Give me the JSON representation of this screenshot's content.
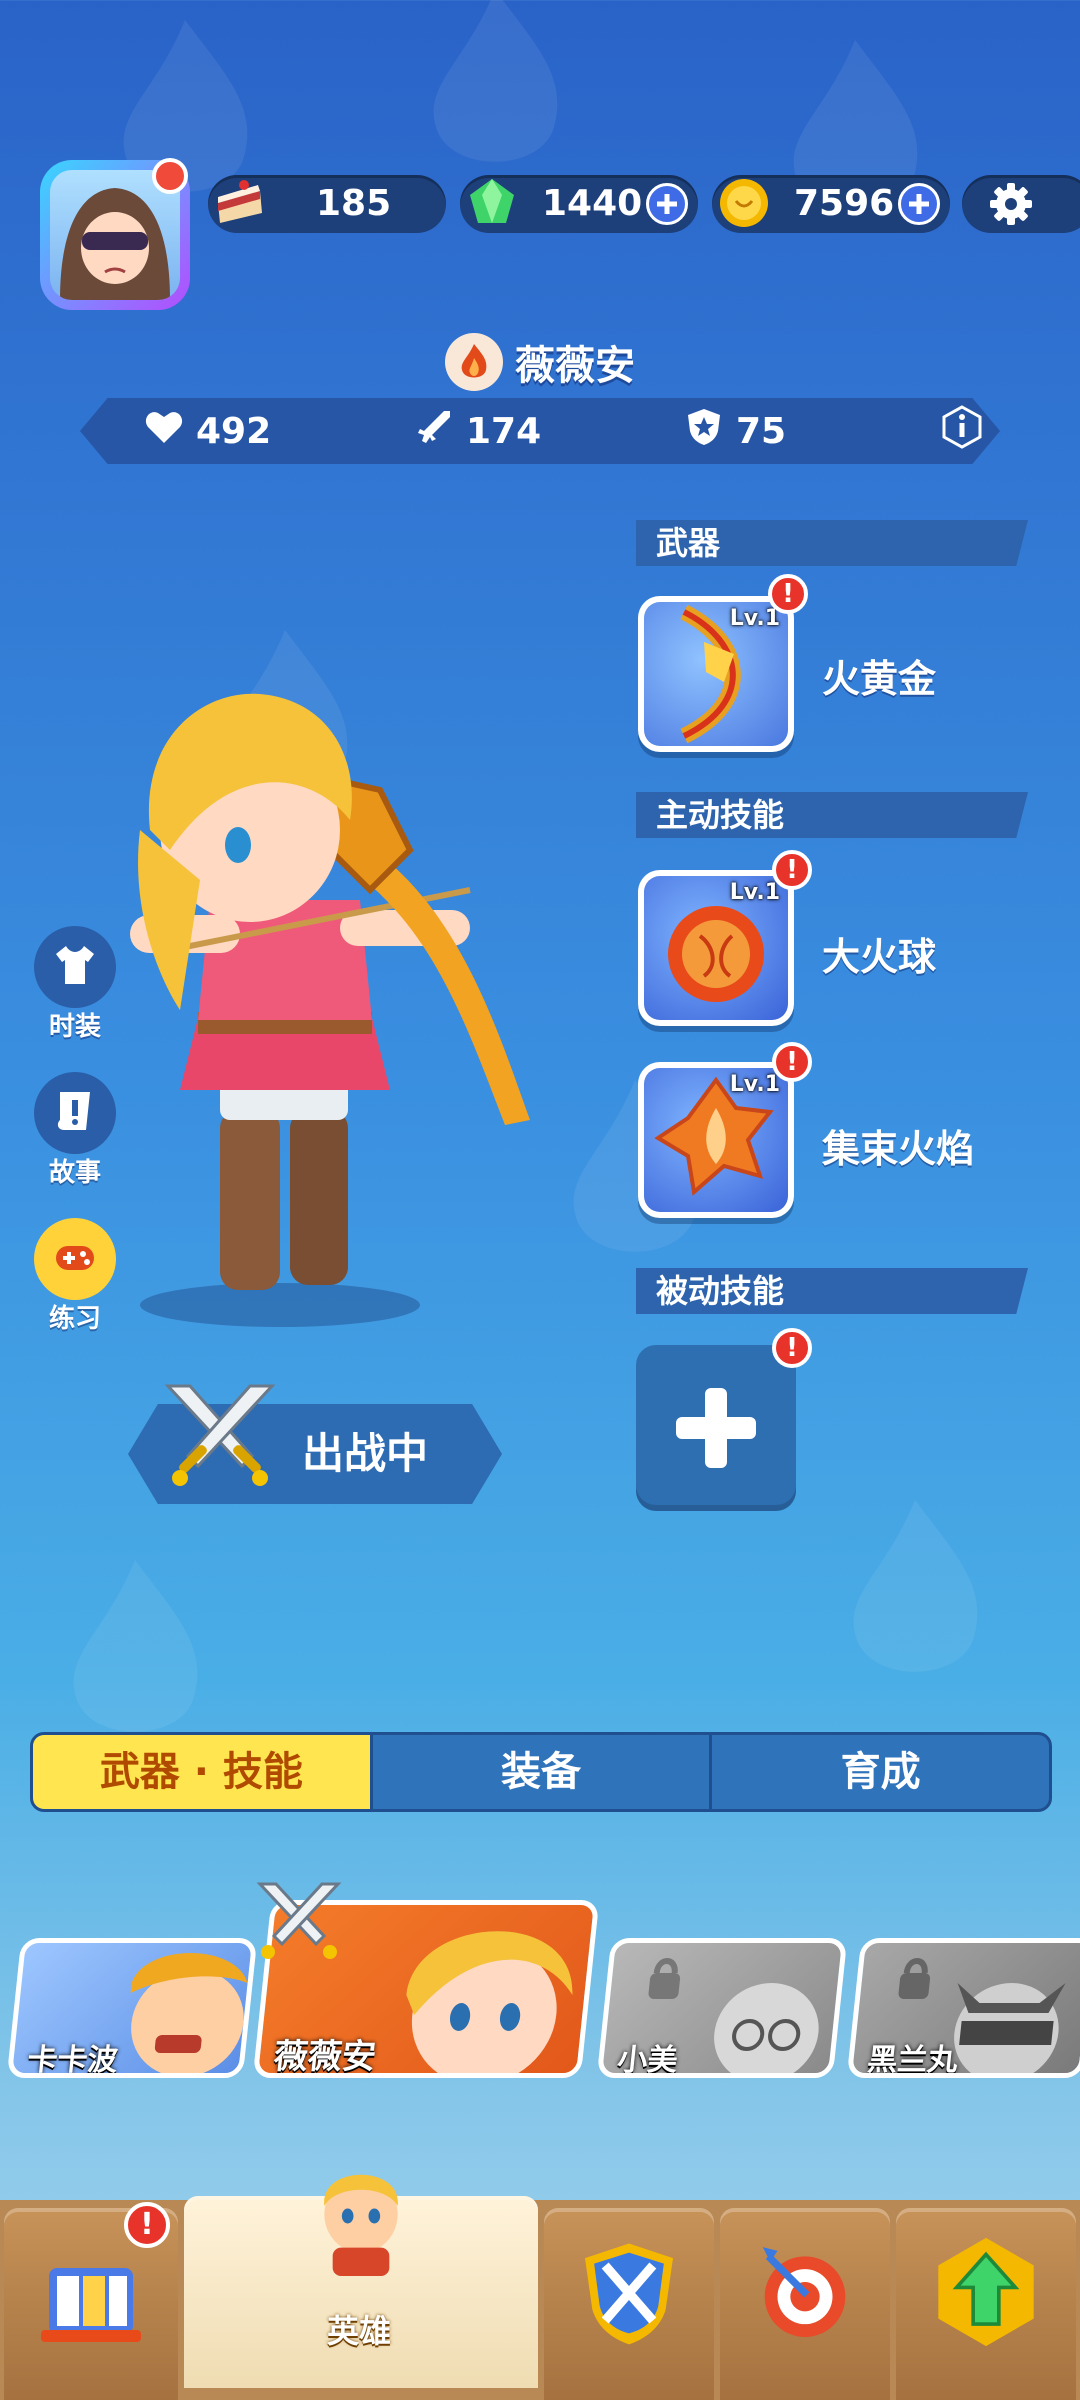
{
  "top_bar": {
    "cake": {
      "value": "185",
      "icon": "cake-icon"
    },
    "gems": {
      "value": "1440",
      "icon": "gem-icon"
    },
    "coins": {
      "value": "7596",
      "icon": "coin-icon"
    }
  },
  "hero": {
    "name": "薇薇安",
    "stats": {
      "health": "492",
      "attack": "174",
      "defense": "75"
    }
  },
  "sections": {
    "weapon": {
      "label": "武器",
      "item": {
        "level": "Lv.1",
        "name": "火黄金"
      }
    },
    "active": {
      "label": "主动技能",
      "skills": [
        {
          "level": "Lv.1",
          "name": "大火球"
        },
        {
          "level": "Lv.1",
          "name": "集束火焰"
        }
      ]
    },
    "passive": {
      "label": "被动技能"
    }
  },
  "side_buttons": [
    {
      "label": "时装",
      "icon": "shirt-icon"
    },
    {
      "label": "故事",
      "icon": "story-icon"
    },
    {
      "label": "练习",
      "icon": "gamepad-icon"
    }
  ],
  "deploy": {
    "label": "出战中"
  },
  "tabs": [
    "武器 · 技能",
    "装备",
    "育成"
  ],
  "hero_cards": [
    {
      "name": "卡卡波",
      "locked": false
    },
    {
      "name": "薇薇安",
      "locked": false,
      "selected": true
    },
    {
      "name": "小美",
      "locked": true
    },
    {
      "name": "黑兰丸",
      "locked": true
    }
  ],
  "bottom_nav": {
    "active_label": "英雄"
  },
  "colors": {
    "accent_yellow": "#ffe54f",
    "alert_red": "#e8332a"
  }
}
